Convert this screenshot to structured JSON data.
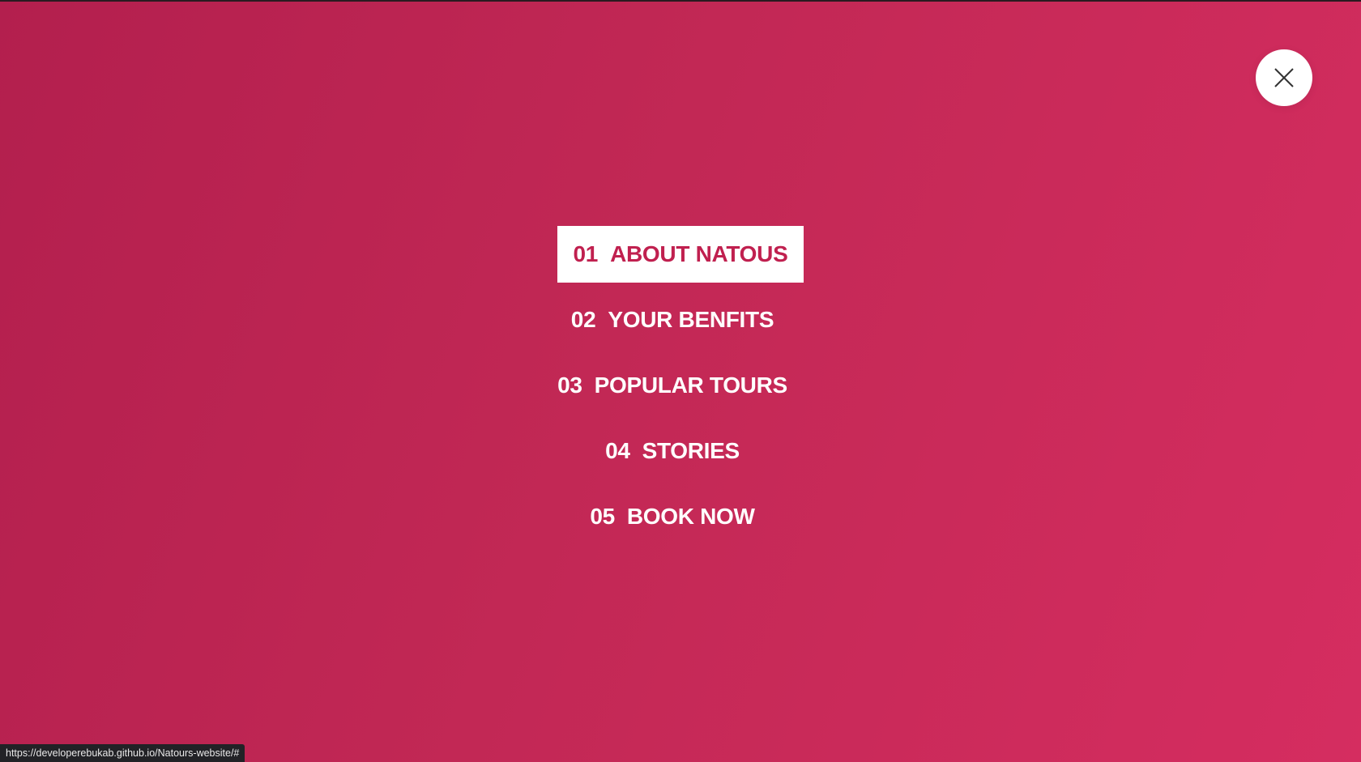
{
  "close_button": {
    "icon": "close-icon"
  },
  "nav": {
    "items": [
      {
        "number": "01",
        "label": "ABOUT NATOUS",
        "active": true
      },
      {
        "number": "02",
        "label": "YOUR BENFITS",
        "active": false
      },
      {
        "number": "03",
        "label": "POPULAR TOURS",
        "active": false
      },
      {
        "number": "04",
        "label": "STORIES",
        "active": false
      },
      {
        "number": "05",
        "label": "BOOK NOW",
        "active": false
      }
    ]
  },
  "status_bar": {
    "url": "https://developerebukab.github.io/Natours-website/#"
  },
  "colors": {
    "background_start": "#b31f4e",
    "background_end": "#d52d60",
    "active_text": "#c0204f",
    "active_bg": "#ffffff",
    "link_text": "#ffffff"
  }
}
